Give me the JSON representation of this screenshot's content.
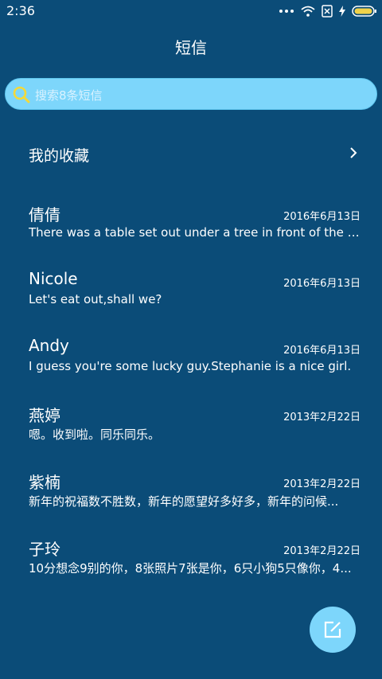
{
  "status_bar": {
    "time": "2:36",
    "icons": [
      "more-dots-icon",
      "wifi-icon",
      "sim-off-icon",
      "charging-icon",
      "battery-icon"
    ],
    "battery_color": "#f0d24a"
  },
  "header": {
    "title": "短信"
  },
  "search": {
    "placeholder": "搜索8条短信",
    "background_color": "#7dd6fb",
    "icon_color": "#f3d93a"
  },
  "favorites": {
    "label": "我的收藏"
  },
  "conversations": [
    {
      "name": "倩倩",
      "date": "2016年6月13日",
      "preview": "There was a table set out under a tree in front of the ho..."
    },
    {
      "name": "Nicole",
      "date": "2016年6月13日",
      "preview": "Let's eat out,shall we?"
    },
    {
      "name": "Andy",
      "date": "2016年6月13日",
      "preview": "I guess you're some lucky guy.Stephanie is a nice girl."
    },
    {
      "name": "燕婷",
      "date": "2013年2月22日",
      "preview": "嗯。收到啦。同乐同乐。"
    },
    {
      "name": "紫楠",
      "date": "2013年2月22日",
      "preview": "新年的祝福数不胜数，新年的愿望好多好多，新年的问候..."
    },
    {
      "name": "子玲",
      "date": "2013年2月22日",
      "preview": "10分想念9别的你，8张照片7张是你，6只小狗5只像你，4..."
    }
  ],
  "compose": {
    "icon": "compose-icon",
    "background_color": "#7dd6fb"
  },
  "theme": {
    "background": "#0b4c78",
    "text": "#ffffff"
  }
}
